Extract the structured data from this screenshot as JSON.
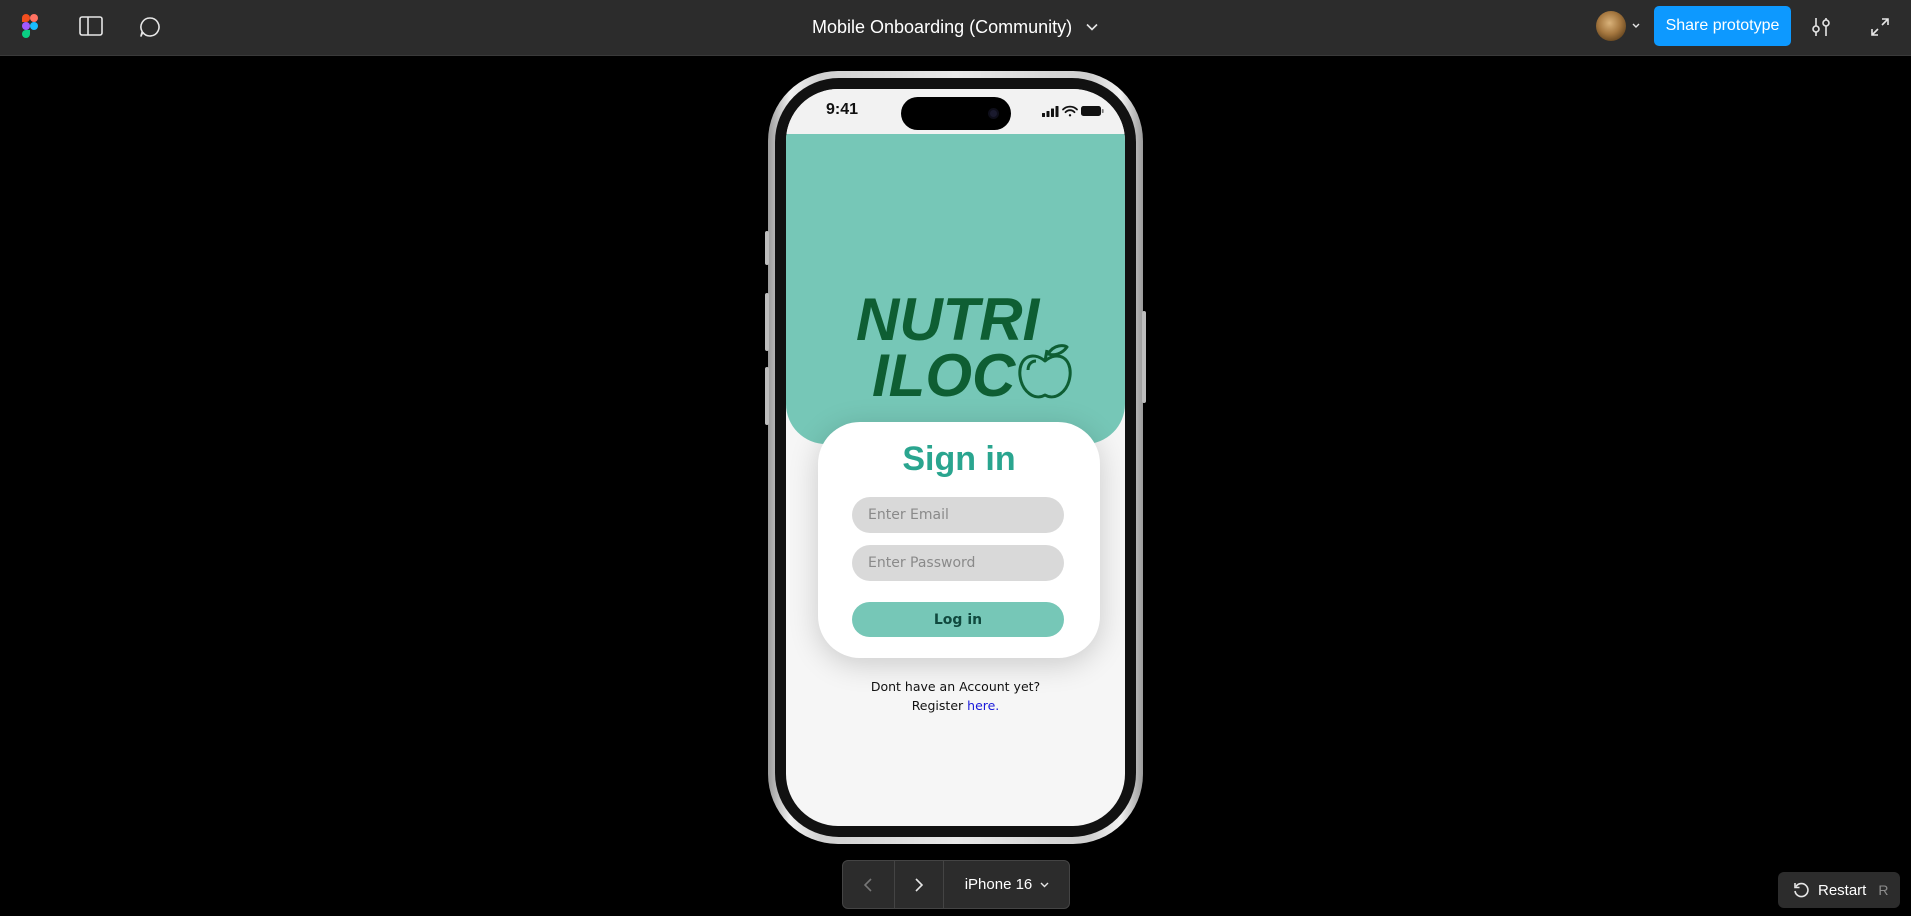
{
  "toolbar": {
    "file_title": "Mobile Onboarding (Community)",
    "share_label": "Share prototype"
  },
  "phone": {
    "status_time": "9:41",
    "logo_line1": "NUTRI",
    "logo_line2": "ILOC",
    "sign_in_title": "Sign in",
    "email_placeholder": "Enter Email",
    "password_placeholder": "Enter Password",
    "login_label": "Log in",
    "register_prefix": "Dont have an Account yet?",
    "register_word": "Register",
    "register_link": "here."
  },
  "bottom": {
    "device_label": "iPhone 16",
    "restart_label": "Restart",
    "restart_shortcut": "R"
  },
  "colors": {
    "accent": "#0d99ff",
    "hero": "#76c7b7",
    "title_green": "#2aa58f",
    "logo_green": "#0e5e33",
    "link_blue": "#1a1adb"
  }
}
